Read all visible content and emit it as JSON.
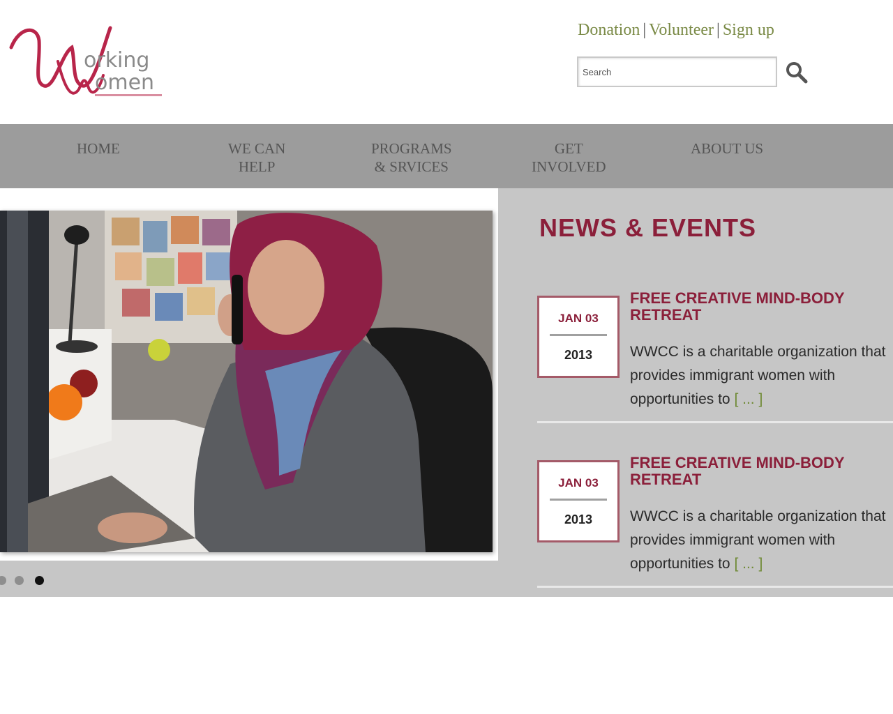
{
  "header": {
    "logo_text": "Working Women",
    "links": [
      "Donation",
      "Volunteer",
      "Sign up"
    ],
    "search_placeholder": "Search"
  },
  "nav": {
    "items": [
      {
        "label": "HOME"
      },
      {
        "label": "WE CAN\nHELP"
      },
      {
        "label": "PROGRAMS\n& SRVICES"
      },
      {
        "label": "GET\nINVOLVED"
      },
      {
        "label": "ABOUT US"
      }
    ]
  },
  "slider": {
    "slide_count": 3,
    "active_index": 2
  },
  "news": {
    "title": "NEWS & EVENTS",
    "events": [
      {
        "month_day": "JAN 03",
        "year": "2013",
        "title": "FREE CREATIVE MIND-BODY RETREAT",
        "description": "WWCC is a charitable organization that provides immigrant women with opportunities to",
        "more": "[ ... ]"
      },
      {
        "month_day": "JAN 03",
        "year": "2013",
        "title": "FREE CREATIVE MIND-BODY RETREAT",
        "description": "WWCC is a charitable organization that provides immigrant women with opportunities to",
        "more": "[ ... ]"
      }
    ]
  },
  "colors": {
    "brand": "#8b1f3a",
    "link_green": "#7a8a46",
    "nav_bg": "#9c9c9c",
    "content_bg": "#c6c6c6"
  }
}
